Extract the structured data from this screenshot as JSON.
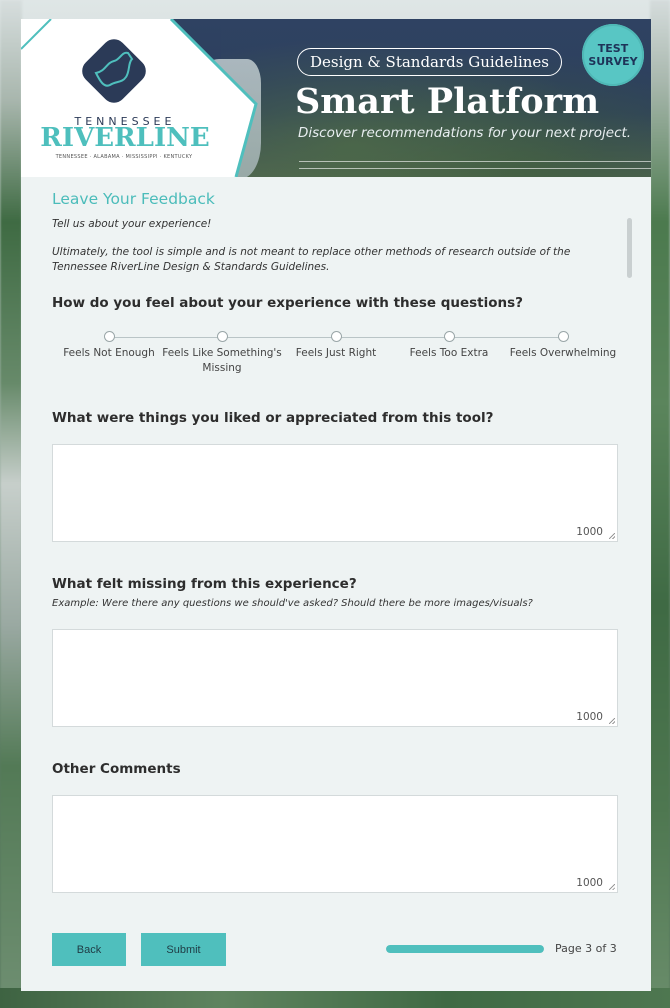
{
  "header": {
    "brand_top": "TENNESSEE",
    "brand_main": "RIVERLINE",
    "brand_sub": "TENNESSEE · ALABAMA · MISSISSIPPI · KENTUCKY",
    "pill": "Design & Standards Guidelines",
    "title": "Smart Platform",
    "subtitle": "Discover recommendations for your next project.",
    "badge_line1": "TEST",
    "badge_line2": "SURVEY"
  },
  "section": {
    "heading": "Leave Your Feedback",
    "intro1": "Tell us about your experience!",
    "intro2": "Ultimately, the tool is simple and is not meant to replace other methods of research outside of the Tennessee RiverLine Design & Standards Guidelines."
  },
  "rating": {
    "question": "How do you feel about your experience with these questions?",
    "options": [
      "Feels Not Enough",
      "Feels Like Something's Missing",
      "Feels Just Right",
      "Feels Too Extra",
      "Feels Overwhelming"
    ]
  },
  "q_liked": {
    "label": "What were things you liked or appreciated from this tool?",
    "counter": "1000"
  },
  "q_missing": {
    "label": "What felt missing from this experience?",
    "hint": "Example: Were there any questions we should've asked? Should there be more images/visuals?",
    "counter": "1000"
  },
  "q_other": {
    "label": "Other Comments",
    "counter": "1000"
  },
  "nav": {
    "back": "Back",
    "submit": "Submit",
    "page": "Page 3 of 3",
    "progress": 1.0
  },
  "colors": {
    "accent": "#4fbfbd",
    "navy": "#2b3a57"
  }
}
